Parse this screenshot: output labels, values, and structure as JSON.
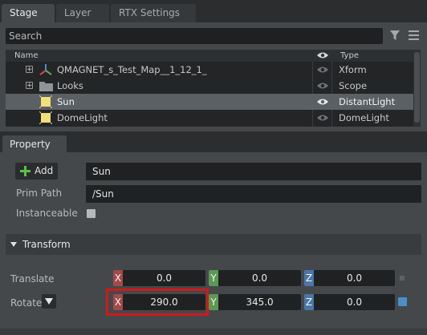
{
  "tabs": [
    {
      "label": "Stage",
      "active": true
    },
    {
      "label": "Layer",
      "active": false
    },
    {
      "label": "RTX Settings",
      "active": false
    }
  ],
  "stage": {
    "search_placeholder": "Search",
    "columns": {
      "name": "Name",
      "type": "Type"
    },
    "rows": [
      {
        "name": "QMAGNET_s_Test_Map__1_12_1_",
        "type": "Xform",
        "icon": "xform-axes-icon",
        "expandable": true
      },
      {
        "name": "Looks",
        "type": "Scope",
        "icon": "folder-icon",
        "expandable": true
      },
      {
        "name": "Sun",
        "type": "DistantLight",
        "icon": "light-icon",
        "expandable": false,
        "selected": true
      },
      {
        "name": "DomeLight",
        "type": "DomeLight",
        "icon": "light-icon",
        "expandable": false
      }
    ]
  },
  "property": {
    "tab_label": "Property",
    "add_label": "Add",
    "name_value": "Sun",
    "prim_path_label": "Prim Path",
    "prim_path_value": "/Sun",
    "instanceable_label": "Instanceable",
    "transform_label": "Transform",
    "translate": {
      "label": "Translate",
      "x": "0.0",
      "y": "0.0",
      "z": "0.0"
    },
    "rotate": {
      "label": "Rotate",
      "x": "290.0",
      "y": "345.0",
      "z": "0.0"
    },
    "axis_labels": {
      "x": "X",
      "y": "Y",
      "z": "Z"
    }
  },
  "colors": {
    "highlight": "#d0191a",
    "x_axis": "#a24a4a",
    "y_axis": "#5a9a52",
    "z_axis": "#4a77a8"
  }
}
